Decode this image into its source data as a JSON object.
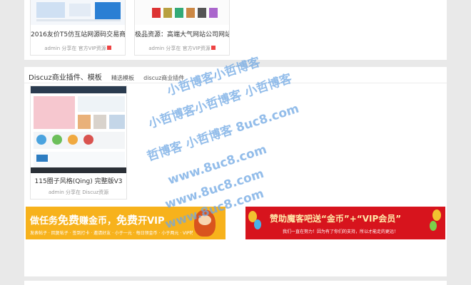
{
  "top_cards": [
    {
      "title": "2016友价T5仿互站网源码交易商",
      "meta": "admin 分享在 官方VIP资源"
    },
    {
      "title": "极品资源：高端大气网站公司网站源",
      "meta": "admin 分享在 官方VIP资源"
    }
  ],
  "section": {
    "title": "Discuz商业插件、模板",
    "tabs": [
      "精选模板",
      "discuz商业插件"
    ]
  },
  "mid_card": {
    "title": "115圈子风格(Qing) 完整版V3",
    "meta": "admin 分享在 Discuz资源"
  },
  "banners": {
    "left": {
      "text_a": "做任务",
      "text_b": "免费",
      "text_c": "赚金币，",
      "text_d": "免费",
      "text_e": "开VIP",
      "sub": "发表帖子 · 回复帖子 · 签到打卡 · 邀请好友 · 小于一元 · 每日领金币 · 小于两元 · VIP特权"
    },
    "right": {
      "headline": "赞助魔客吧送“金币”+“VIP会员”",
      "sub": "我们一直在努力！因为有了你们的支持，所以才能走的更远！"
    }
  },
  "watermark": {
    "line1": "小哲博客小哲博客",
    "line2": "小哲博客小哲博客 小哲博客",
    "line3": "哲博客 小哲博客 8uc8.com",
    "line4": "www.8uc8.com",
    "line5": "www.8uc8.com",
    "line6": "www.8uc8.com"
  },
  "colors": {
    "left_banner_bg": "#f7b21c",
    "right_banner_bg": "#d7141d",
    "watermark": "#6fa7e3"
  }
}
